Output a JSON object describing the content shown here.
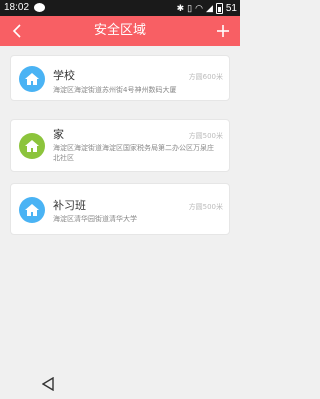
{
  "status_bar": {
    "time": "18:02",
    "battery_level": "51",
    "icons": [
      "chat-bubble-icon",
      "bluetooth-icon",
      "vibrate-icon",
      "wifi-icon",
      "signal-icon",
      "battery-icon"
    ]
  },
  "header": {
    "title": "安全区域",
    "back_icon": "chevron-left-icon",
    "add_icon": "plus-icon",
    "background": "#f85f64"
  },
  "zones": [
    {
      "name": "学校",
      "radius": "方圆600米",
      "address": "海淀区海淀街道苏州街4号神州数码大厦",
      "icon": "house-icon",
      "icon_color": "#4ab3f4"
    },
    {
      "name": "家",
      "radius": "方圆500米",
      "address": "海淀区海淀街道海淀区国家税务局第二办公区万泉庄北社区",
      "icon": "house-icon",
      "icon_color": "#8cc43c"
    },
    {
      "name": "补习班",
      "radius": "方圆500米",
      "address": "海淀区清华园街道清华大学",
      "icon": "house-icon",
      "icon_color": "#4ab3f4"
    }
  ],
  "nav_bar": {
    "back_icon": "triangle-back-icon"
  }
}
